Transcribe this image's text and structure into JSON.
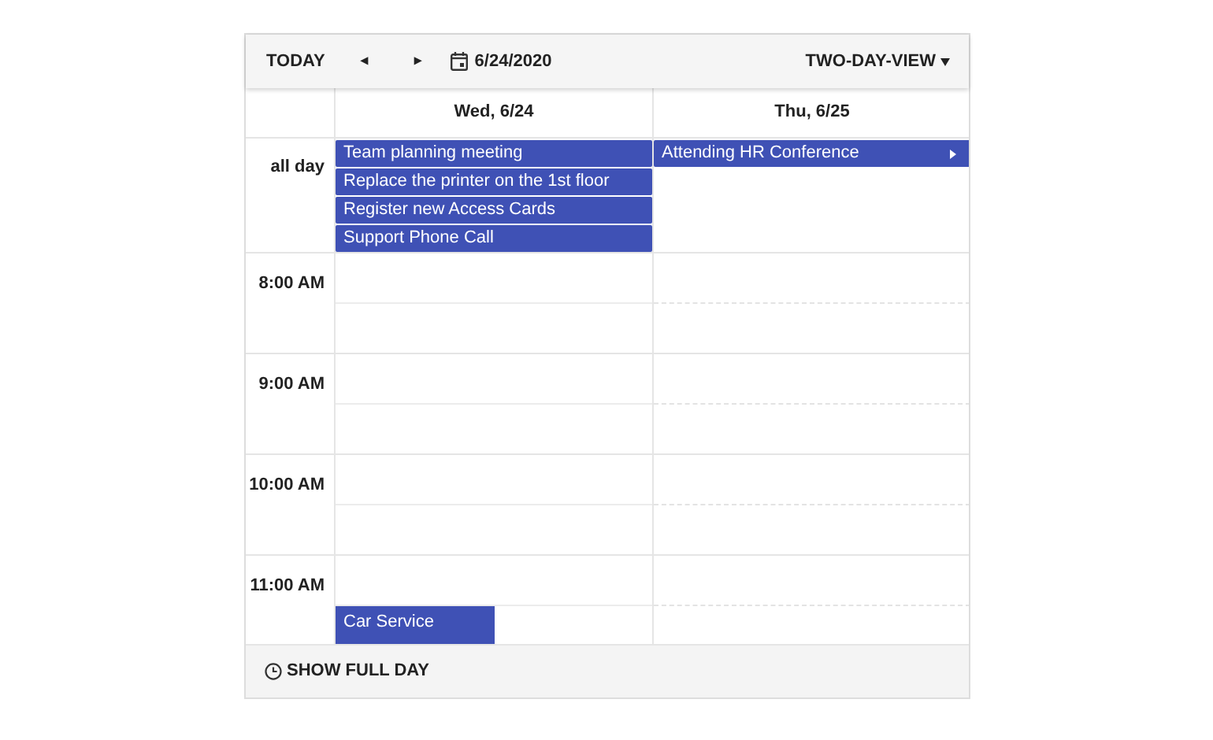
{
  "toolbar": {
    "today": "TODAY",
    "prev": "◂",
    "next": "▸",
    "date": "6/24/2020",
    "view": "TWO-DAY-VIEW"
  },
  "days": [
    {
      "label": "Wed, 6/24",
      "all_day_events": [
        {
          "title": "Team planning meeting",
          "continues": false
        },
        {
          "title": "Replace the printer on the 1st floor",
          "continues": false
        },
        {
          "title": "Register new Access Cards",
          "continues": false
        },
        {
          "title": "Support Phone Call",
          "continues": false
        }
      ]
    },
    {
      "label": "Thu, 6/25",
      "all_day_events": [
        {
          "title": "Attending HR Conference",
          "continues": true
        }
      ]
    }
  ],
  "all_day_label": "all day",
  "time_rows": [
    {
      "label": "8:00 AM"
    },
    {
      "label": "9:00 AM"
    },
    {
      "label": "10:00 AM"
    },
    {
      "label": "11:00 AM",
      "cells": [
        {
          "second_half_events": [
            {
              "title": "Car Service"
            }
          ]
        },
        {}
      ]
    }
  ],
  "footer": {
    "label": "SHOW FULL DAY"
  }
}
